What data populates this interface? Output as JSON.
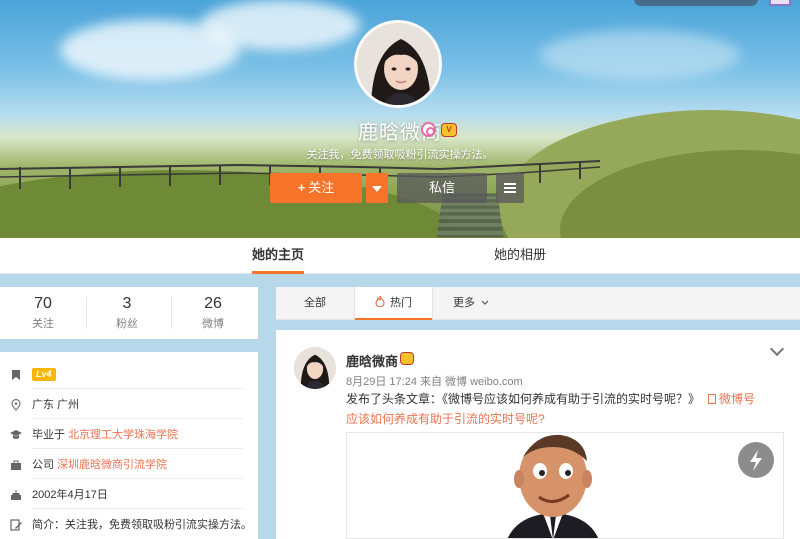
{
  "profile": {
    "name": "鹿晗微商",
    "intro": "关注我，免费领取吸粉引流实操方法。",
    "follow_label": "关注",
    "follow_plus": "+",
    "message_label": "私信"
  },
  "tabs": [
    {
      "label": "她的主页",
      "active": true
    },
    {
      "label": "她的相册",
      "active": false
    }
  ],
  "stats": [
    {
      "value": "70",
      "label": "关注"
    },
    {
      "value": "3",
      "label": "粉丝"
    },
    {
      "value": "26",
      "label": "微博"
    }
  ],
  "info": {
    "level": "Lv4",
    "location": "广东 广州",
    "education_prefix": "毕业于",
    "education": "北京理工大学珠海学院",
    "company_prefix": "公司",
    "company": "深圳鹿晗微商引流学院",
    "birthday": "2002年4月17日",
    "bio_prefix": "简介：",
    "bio": "关注我，免费领取吸粉引流实操方法。"
  },
  "filters": [
    {
      "label": "全部",
      "active": false
    },
    {
      "label": "热门",
      "active": true
    },
    {
      "label": "更多",
      "active": false
    }
  ],
  "post": {
    "author": "鹿晗微商",
    "meta": "8月29日 17:24 来自 微博 weibo.com",
    "text_prefix": "发布了头条文章：《微博号应该如何养成有助于引流的实时号呢？》",
    "link_line1": "微博号",
    "link_line2": "应该如何养成有助于引流的实时号呢?"
  },
  "colors": {
    "accent": "#f5742a",
    "link": "#eb7350",
    "level_badge": "#f8b600",
    "page_bg": "#b7d7ea"
  }
}
